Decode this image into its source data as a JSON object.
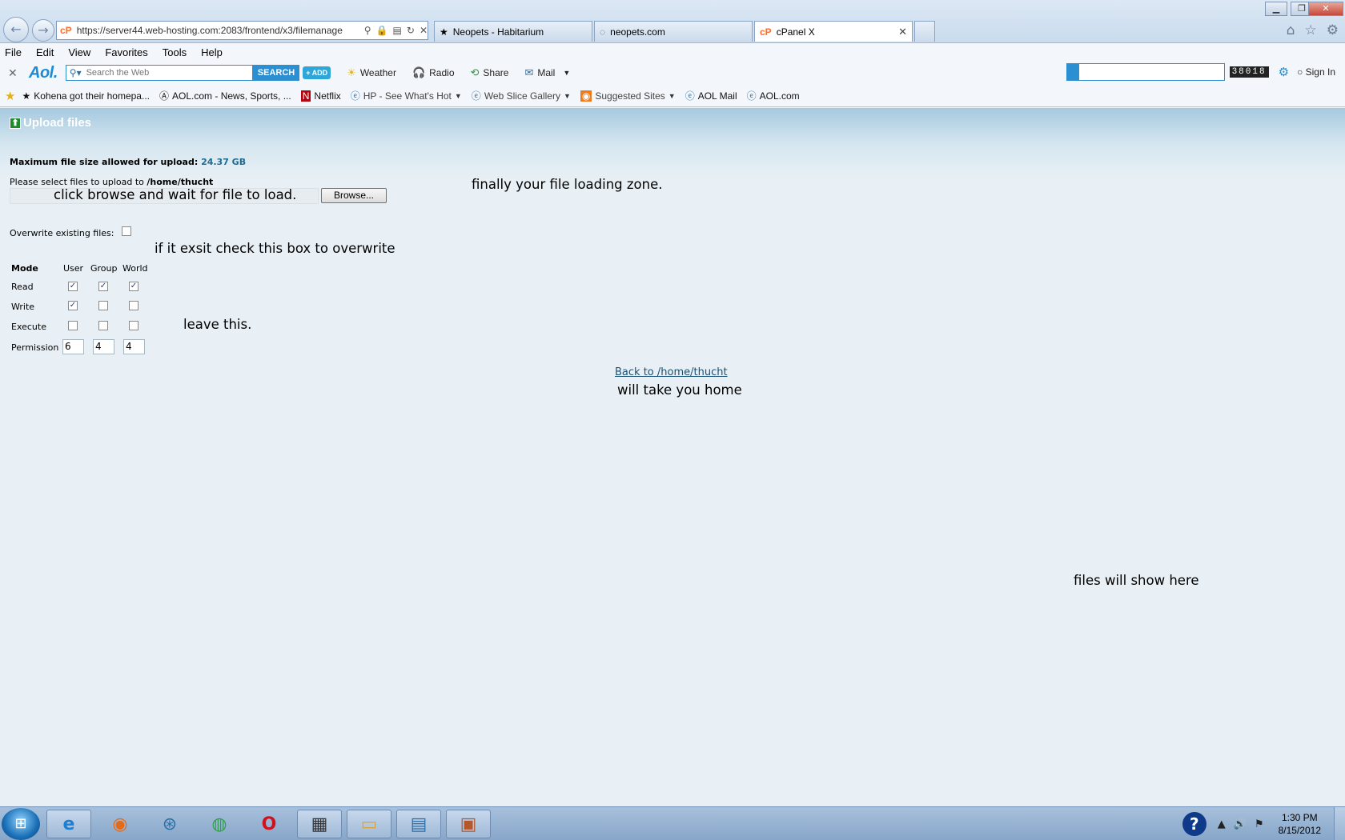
{
  "browser": {
    "address_url": "https://server44.web-hosting.com:2083/frontend/x3/filemanage",
    "tabs": [
      {
        "label": "Neopets - Habitarium"
      },
      {
        "label": "neopets.com"
      },
      {
        "label": "cPanel X"
      }
    ],
    "menu": [
      "File",
      "Edit",
      "View",
      "Favorites",
      "Tools",
      "Help"
    ]
  },
  "aol_toolbar": {
    "logo": "Aol.",
    "search_placeholder": "Search the Web",
    "search_button": "SEARCH",
    "add_button": "+ ADD",
    "items": [
      "Weather",
      "Radio",
      "Share",
      "Mail"
    ],
    "counter": "38018",
    "sign_in": "Sign In"
  },
  "favorites": [
    {
      "label": "Kohena got their homepa..."
    },
    {
      "label": "AOL.com - News, Sports, ..."
    },
    {
      "label": "Netflix"
    },
    {
      "label": "HP - See What's Hot"
    },
    {
      "label": "Web Slice Gallery"
    },
    {
      "label": "Suggested Sites"
    },
    {
      "label": "AOL Mail"
    },
    {
      "label": "AOL.com"
    }
  ],
  "page": {
    "title": "Upload files",
    "max_size_label": "Maximum file size allowed for upload:",
    "max_size_value": "24.37 GB",
    "select_label": "Please select files to upload to",
    "select_path": "/home/thucht",
    "browse_button": "Browse...",
    "overwrite_label": "Overwrite existing files:",
    "mode_table": {
      "header": [
        "Mode",
        "User",
        "Group",
        "World"
      ],
      "rows": [
        {
          "label": "Read",
          "checked": [
            true,
            true,
            true
          ]
        },
        {
          "label": "Write",
          "checked": [
            true,
            false,
            false
          ]
        },
        {
          "label": "Execute",
          "checked": [
            false,
            false,
            false
          ]
        }
      ],
      "permission_label": "Permission",
      "permission_values": [
        "6",
        "4",
        "4"
      ]
    },
    "back_link": "Back to /home/thucht"
  },
  "annotations": {
    "browse_note": "click browse and wait for file to load.",
    "loading_zone_note": "finally your file loading zone.",
    "overwrite_note": "if it exsit check this box to overwrite",
    "leave_note": "leave this.",
    "home_note": "will take you home",
    "files_note": "files will show here"
  },
  "taskbar": {
    "time": "1:30 PM",
    "date": "8/15/2012"
  }
}
